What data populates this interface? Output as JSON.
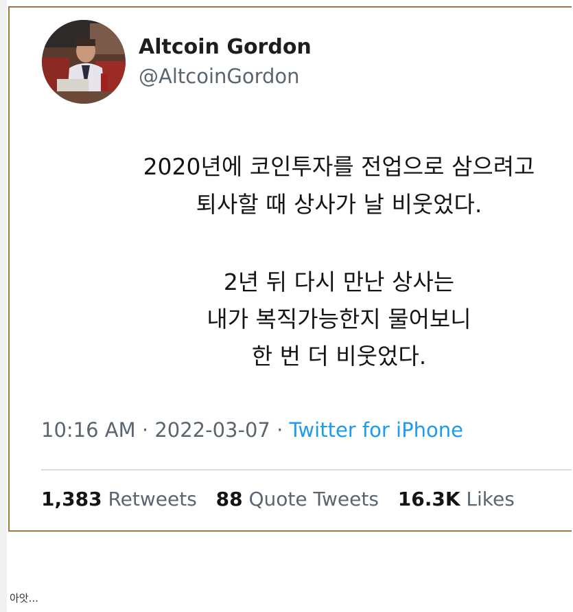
{
  "tweet": {
    "author": {
      "display_name": "Altcoin Gordon",
      "handle": "@AltcoinGordon"
    },
    "text_lines": [
      "2020년에 코인투자를 전업으로 삼으려고",
      "퇴사할 때 상사가 날 비웃었다.",
      "2년 뒤 다시 만난 상사는",
      "내가 복직가능한지 물어보니",
      "한 번 더 비웃었다."
    ],
    "meta": {
      "time": "10:16 AM",
      "separator": " · ",
      "date": "2022-03-07",
      "source": "Twitter for iPhone"
    },
    "stats": {
      "retweets_count": "1,383",
      "retweets_label": "Retweets",
      "quote_tweets_count": "88",
      "quote_tweets_label": "Quote Tweets",
      "likes_count": "16.3K",
      "likes_label": "Likes"
    },
    "colors": {
      "frame_border": "#9c7a3c",
      "link_blue": "#1d9bf0",
      "secondary_text": "#5b6570"
    }
  },
  "caption": "아앗..."
}
